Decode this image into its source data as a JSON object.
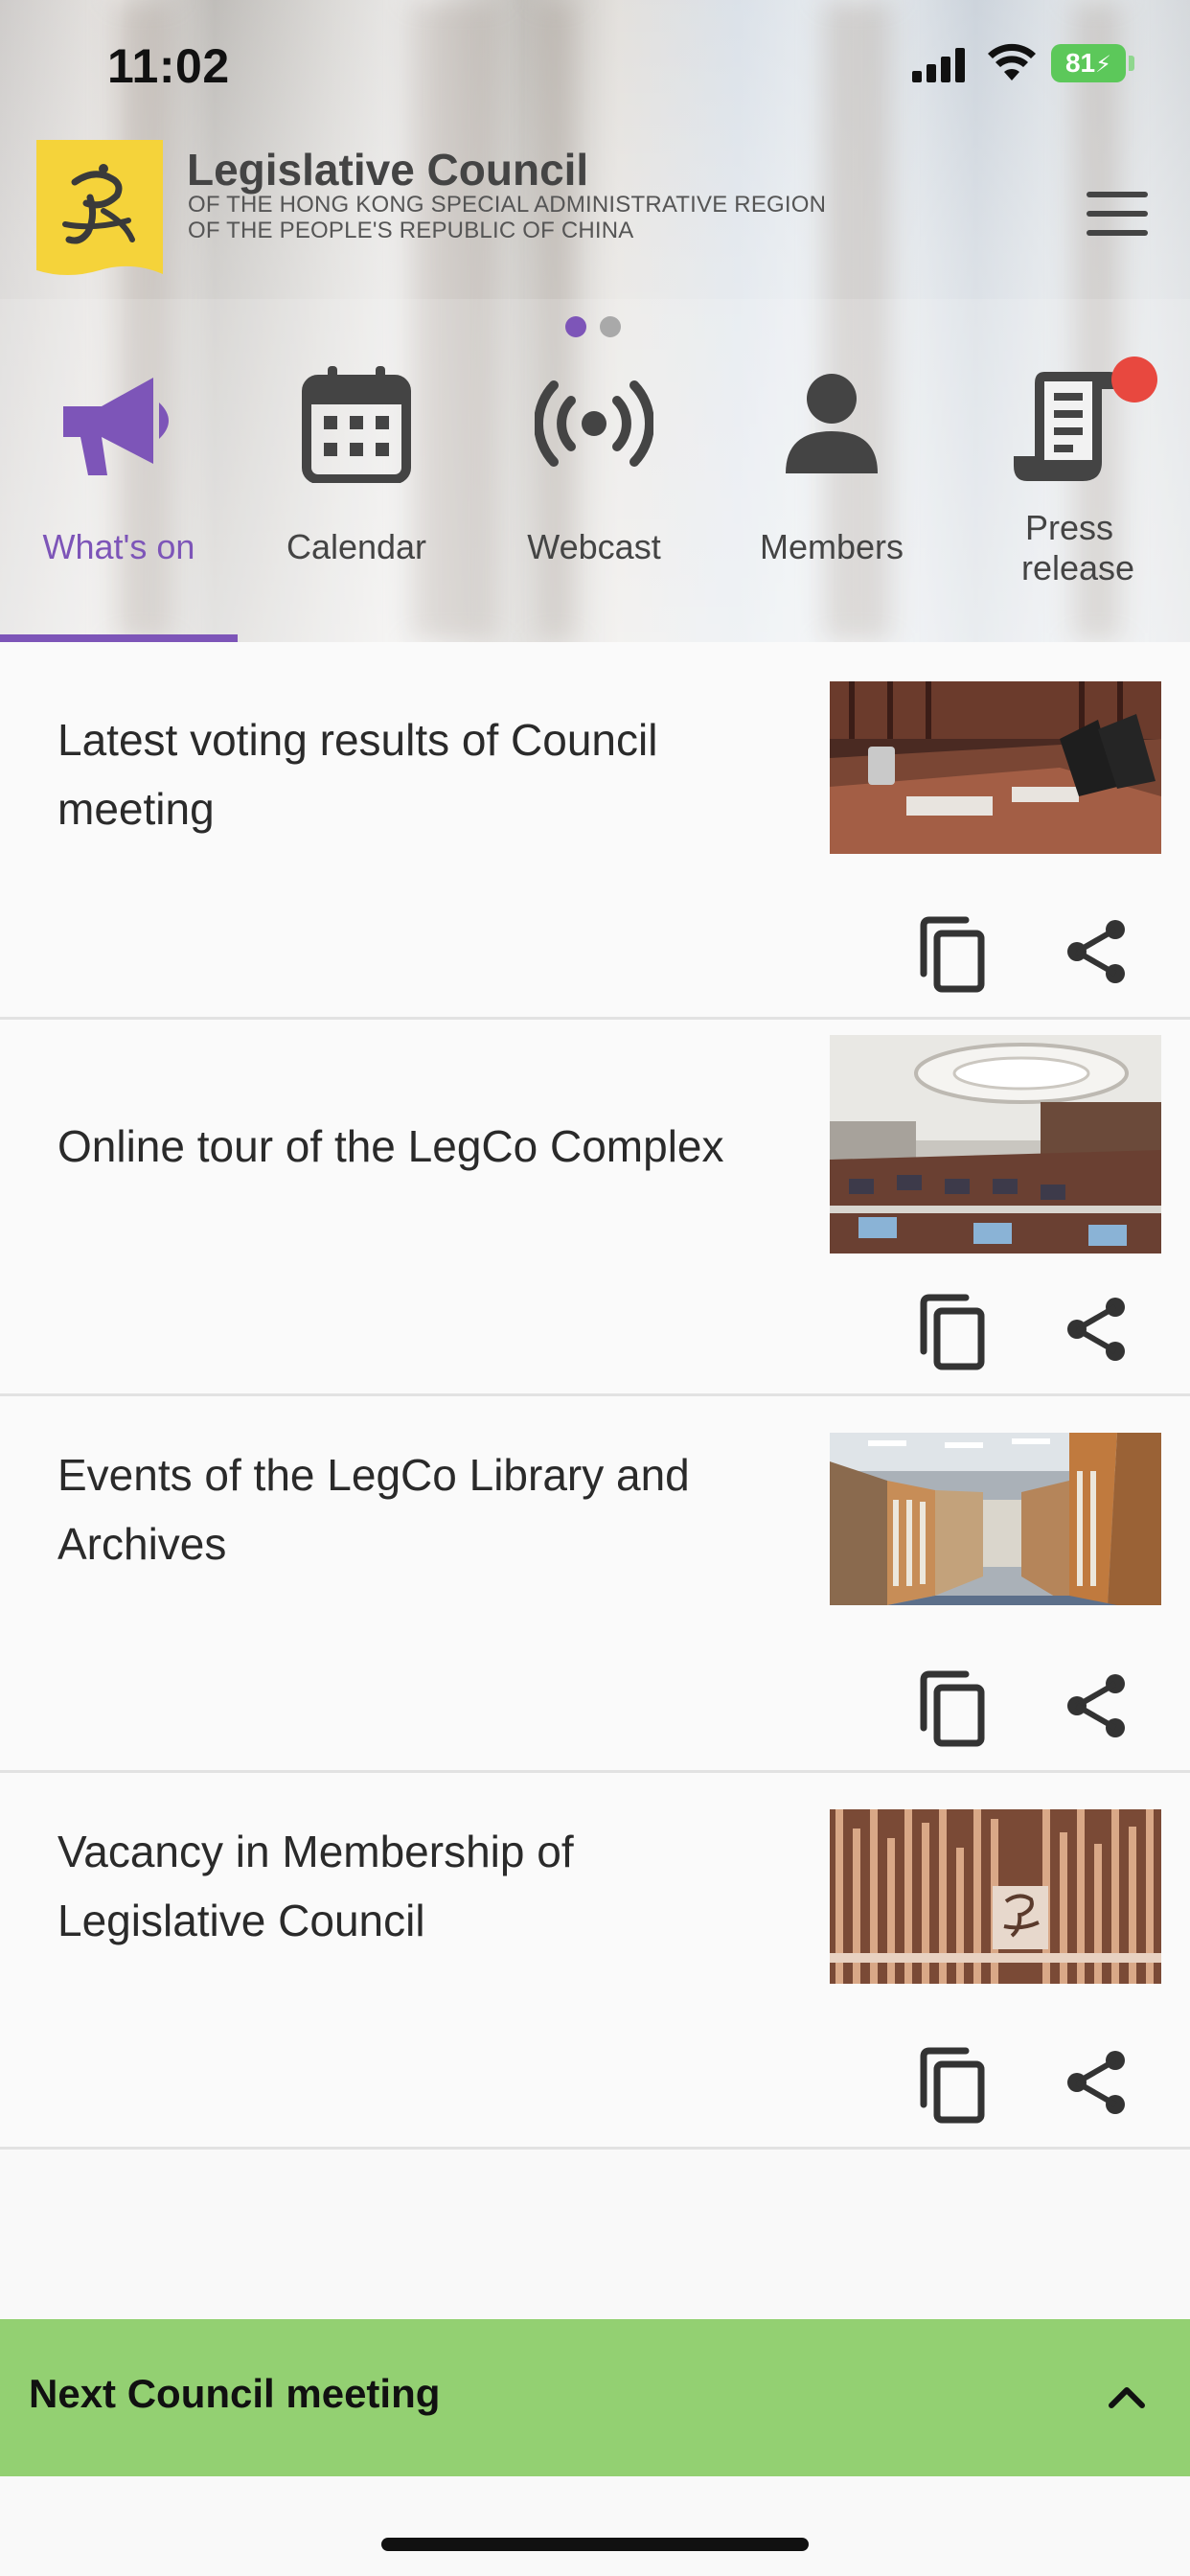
{
  "status_bar": {
    "time": "11:02",
    "battery": "81"
  },
  "header": {
    "title": "Legislative Council",
    "subtitle_line1": "OF THE HONG KONG SPECIAL ADMINISTRATIVE REGION",
    "subtitle_line2": "OF THE PEOPLE'S REPUBLIC OF CHINA",
    "logo_icon": "legco-logo-icon",
    "menu_icon": "hamburger-menu-icon"
  },
  "nav": {
    "active_index": 0,
    "items": [
      {
        "label": "What's on",
        "icon": "megaphone-icon"
      },
      {
        "label": "Calendar",
        "icon": "calendar-icon"
      },
      {
        "label": "Webcast",
        "icon": "broadcast-icon"
      },
      {
        "label": "Members",
        "icon": "person-icon"
      },
      {
        "label": "Press release",
        "icon": "scroll-document-icon",
        "badge": true
      }
    ],
    "pager_dots": 2,
    "pager_active": 0
  },
  "articles": [
    {
      "title": "Latest voting results of Council meeting",
      "image": "council-chamber-desks-photo"
    },
    {
      "title": "Online tour of the LegCo Complex",
      "image": "legco-chamber-photo"
    },
    {
      "title": "Events of the LegCo Library and Archives",
      "image": "library-shelves-photo"
    },
    {
      "title": "Vacancy in Membership of Legislative Council",
      "image": "legco-wall-emblem-photo"
    }
  ],
  "bottom_bar": {
    "label": "Next Council meeting",
    "icon": "chevron-up-icon"
  },
  "colors": {
    "accent": "#7d55b8",
    "badge": "#e8483f",
    "bottom_bar": "#93d072",
    "logo_yellow": "#f5d33a",
    "battery": "#5cc85a"
  }
}
